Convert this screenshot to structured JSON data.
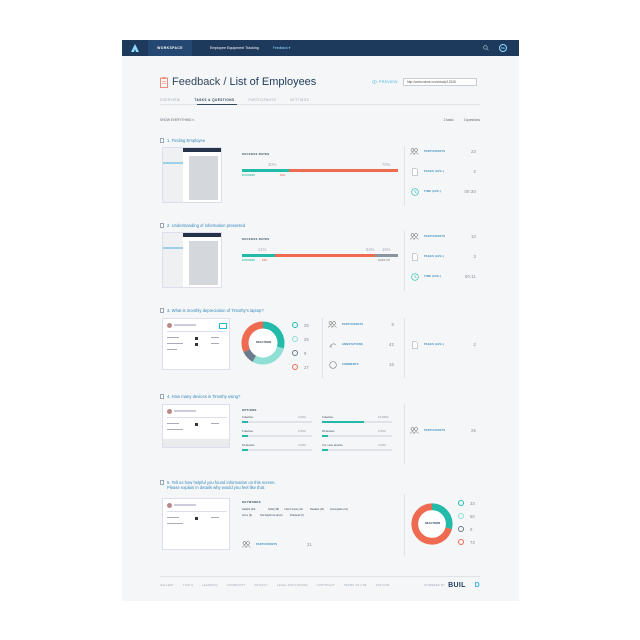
{
  "topbar": {
    "beta": "BETA",
    "workspace": "WORKSPACE",
    "crumb": "Employee Equipment Tracking",
    "crumb_active": "Feedback",
    "avatar": "BE"
  },
  "header": {
    "title_prefix": "Feedback /",
    "title_main": "List of Employees",
    "preview": "PREVIEW",
    "url": "http://www.name.com/study/12345"
  },
  "tabs": [
    "OVERVIEW",
    "TASKS & QUESTIONS",
    "PARTICIPANTS",
    "SETTINGS"
  ],
  "show": {
    "label": "SHOW EVERYTHING",
    "tasks": "2 tasks",
    "questions": "3 questions"
  },
  "tasks": [
    {
      "title": "1. Finding Employee",
      "rates_label": "SUCCESS RATES",
      "success_pct": "30%",
      "fail_pct": "70%",
      "success_lbl": "SUCCESS",
      "fail_lbl": "FAIL",
      "success_val": 30,
      "fail_val": 70,
      "participants_lbl": "PARTICIPANTS",
      "participants": "23",
      "pages_lbl": "PAGES (AVG.)",
      "pages": "2",
      "time_lbl": "TIME (AVG.)",
      "time": "00:30"
    },
    {
      "title": "2. Understanding of information presented",
      "rates_label": "SUCCESS RATES",
      "success_pct": "21%",
      "fail_pct": "64%",
      "giveup_pct": "15%",
      "success_lbl": "SUCCESS",
      "fail_lbl": "FAIL",
      "giveup_lbl": "GAVE UP",
      "success_val": 21,
      "fail_val": 64,
      "giveup_val": 15,
      "participants_lbl": "PARTICIPANTS",
      "participants": "10",
      "pages_lbl": "PAGES (AVG.)",
      "pages": "3",
      "time_lbl": "TIME (AVG.)",
      "time": "00:11"
    }
  ],
  "q3": {
    "title": "3. What is monthly depreciation of Timothy's laptop?",
    "donut_label": "REACTIONS",
    "reactions": [
      {
        "value": "25",
        "color": "#22bbaa",
        "fraction": 0.29
      },
      {
        "value": "25",
        "color": "#8fe0d4",
        "fraction": 0.29
      },
      {
        "value": "9",
        "color": "#6b7c8c",
        "fraction": 0.1
      },
      {
        "value": "27",
        "color": "#ee6a50",
        "fraction": 0.32
      }
    ],
    "participants_lbl": "PARTICIPANTS",
    "participants": "8",
    "annotations_lbl": "ANNOTATIONS",
    "annotations": "42",
    "comments_lbl": "COMMENTS",
    "comments": "16",
    "pages_lbl": "PAGES (AVG.)",
    "pages": "2"
  },
  "q4": {
    "title": "4. How many devices is Timothy using?",
    "options_label": "OPTIONS",
    "options": [
      {
        "label": "0 devices",
        "pct": "0 (0%)",
        "fill": 0.08
      },
      {
        "label": "5 devices",
        "pct": "0 (0%)",
        "fill": 0.08
      },
      {
        "label": "10 devices",
        "pct": "0 (0%)",
        "fill": 0.08
      },
      {
        "label": "0 devices",
        "pct": "15 (60%)",
        "fill": 0.6
      },
      {
        "label": "20 devices",
        "pct": "0 (0%)",
        "fill": 0.08
      },
      {
        "label": "0 or more devices",
        "pct": "0 (0%)",
        "fill": 0.08
      }
    ],
    "participants_lbl": "PARTICIPANTS",
    "participants": "25"
  },
  "q5": {
    "title_line1": "5. Tell us how helpful you found information on this screen.",
    "title_line2": "Please explain in details why would you feel like that.",
    "keywords_label": "KEYWORDS",
    "keywords": [
      "Helpful (33)",
      "Solid (18)",
      "I don't know (11)",
      "Needed (11)",
      "Incomplete (11)",
      "Hmm (9)",
      "Not helpful at all (2)",
      "Practical (2)"
    ],
    "participants_lbl": "PARTICIPANTS",
    "participants": "21",
    "donut_label": "REACTIONS",
    "reactions": [
      {
        "value": "33",
        "color": "#22bbaa",
        "fraction": 0.29
      },
      {
        "value": "50",
        "color": "#8fe0d4",
        "fraction": 0.0
      },
      {
        "value": "0",
        "color": "#6b7c8c",
        "fraction": 0.0
      },
      {
        "value": "73",
        "color": "#ee6a50",
        "fraction": 0.71
      }
    ]
  },
  "footer": {
    "links": [
      "GALLERY",
      "TOOLS",
      "LEARNING",
      "COMMUNITY",
      "PRIVACY",
      "LEGAL DISCLOSURE",
      "COPYRIGHT",
      "TERMS OF USE",
      "SAP.COM"
    ],
    "powered": "POWERED BY",
    "build_a": "BUIL",
    "build_b": "D"
  }
}
